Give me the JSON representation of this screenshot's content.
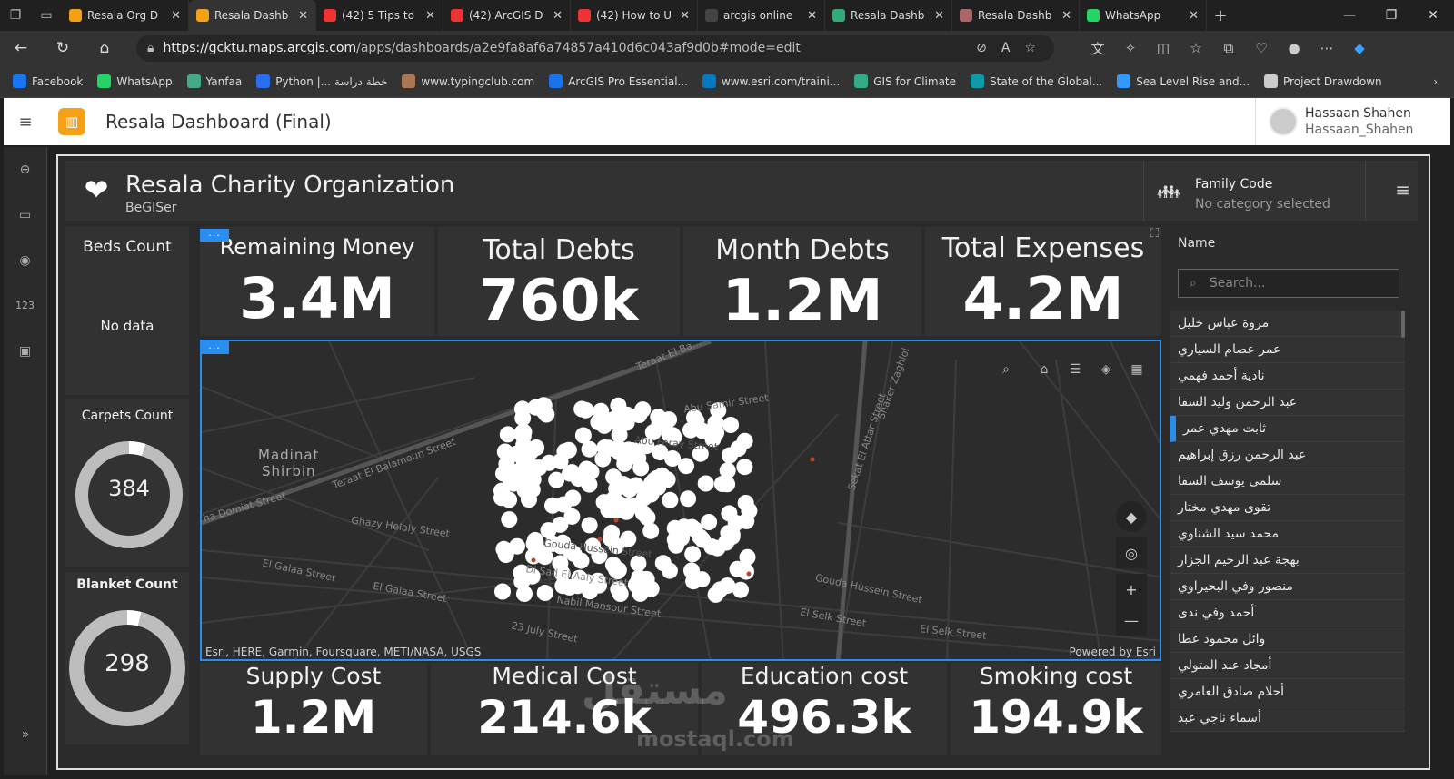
{
  "browser": {
    "tabs": [
      {
        "label": "Resala Org D",
        "color": "#f4a118",
        "active": false
      },
      {
        "label": "Resala Dashb",
        "color": "#f4a118",
        "active": true
      },
      {
        "label": "(42) 5 Tips to",
        "color": "#e33",
        "active": false
      },
      {
        "label": "(42) ArcGIS D",
        "color": "#e33",
        "active": false
      },
      {
        "label": "(42) How to U",
        "color": "#e33",
        "active": false
      },
      {
        "label": "arcgis online",
        "color": "#444",
        "active": false
      },
      {
        "label": "Resala Dashb",
        "color": "#3a7",
        "active": false
      },
      {
        "label": "Resala Dashb",
        "color": "#a66",
        "active": false
      },
      {
        "label": "WhatsApp",
        "color": "#25d366",
        "active": false
      }
    ],
    "url_host": "https://gcktu.maps.arcgis.com",
    "url_path": "/apps/dashboards/a2e9fa8af6a74857a410d6c043af9d0b#mode=edit",
    "bookmarks": [
      {
        "label": "Facebook",
        "color": "#1877f2"
      },
      {
        "label": "WhatsApp",
        "color": "#25d366"
      },
      {
        "label": "Yanfaa",
        "color": "#4a8"
      },
      {
        "label": "Python |... خطة دراسة",
        "color": "#2a6ef0"
      },
      {
        "label": "www.typingclub.com",
        "color": "#a75"
      },
      {
        "label": "ArcGIS Pro Essential...",
        "color": "#1a73e8"
      },
      {
        "label": "www.esri.com/traini...",
        "color": "#0079c1"
      },
      {
        "label": "GIS for Climate",
        "color": "#3a8"
      },
      {
        "label": "State of the Global...",
        "color": "#19a"
      },
      {
        "label": "Sea Level Rise and...",
        "color": "#39f"
      },
      {
        "label": "Project Drawdown",
        "color": "#ccc"
      }
    ]
  },
  "app": {
    "title": "Resala Dashboard (Final)",
    "user_name": "Hassaan Shahen",
    "user_handle": "Hassaan_Shahen"
  },
  "dashboard": {
    "org_name": "Resala Charity Organization",
    "org_sub": "BeGISer",
    "family_label": "Family Code",
    "family_value": "No category selected",
    "beds": {
      "title": "Beds Count",
      "value": "No data"
    },
    "carpets": {
      "title": "Carpets Count",
      "value": "384",
      "fraction": 0.95
    },
    "blankets": {
      "title": "Blanket Count",
      "value": "298",
      "fraction": 0.96
    },
    "top_indicators": [
      {
        "title": "Remaining Money",
        "value": "3.4M"
      },
      {
        "title": "Total Debts",
        "value": "760k"
      },
      {
        "title": "Month Debts",
        "value": "1.2M"
      },
      {
        "title": "Total Expenses",
        "value": "4.2M"
      }
    ],
    "bottom_indicators": [
      {
        "title": "Supply Cost",
        "value": "1.2M"
      },
      {
        "title": "Medical Cost",
        "value": "214.6k"
      },
      {
        "title": "Education cost",
        "value": "496.3k"
      },
      {
        "title": "Smoking cost",
        "value": "194.9k"
      }
    ],
    "map": {
      "city": [
        "Madinat",
        "Shirbin"
      ],
      "streets": [
        "Teraat El Ba...",
        "Abu Samir Street",
        "Shaker Zaghlol",
        "Abu Feray Street",
        "Teraat El Balamoun Street",
        "Ghazy Helaly Street",
        "Gouda Hussein Street",
        "Dl Sad El Aaly Street",
        "El Galaa Street",
        "El Galaa Street",
        "Nabil Mansour Street",
        "Sekat El Attar Street",
        "Gouda Hussein Street",
        "El Selk Street",
        "El Selk Street",
        "23 July Street",
        "ha Domiat Street"
      ],
      "attribution": "Esri, HERE, Garmin, Foursquare, METI/NASA, USGS",
      "powered": "Powered by Esri"
    },
    "list": {
      "header": "Name",
      "search_placeholder": "Search...",
      "names": [
        "مروة عباس خليل",
        "عمر عصام السياري",
        "نادية أحمد فهمي",
        "عبد الرحمن وليد السقا",
        "ثابت مهدي عمر",
        "عبد الرحمن رزق إبراهيم",
        "سلمى يوسف السقا",
        "تقوى مهدي مختار",
        "محمد سيد الشناوي",
        "بهجة عبد الرحيم الجزار",
        "منصور وفي البحيراوي",
        "أحمد وفي ندى",
        "وائل محمود عطا",
        "أمجاد عبد المتولي",
        "أحلام صادق العامري",
        "أسماء ناجي عبد"
      ],
      "selected_index": 4
    }
  },
  "watermark": [
    "مستقل",
    "mostaql.com"
  ]
}
